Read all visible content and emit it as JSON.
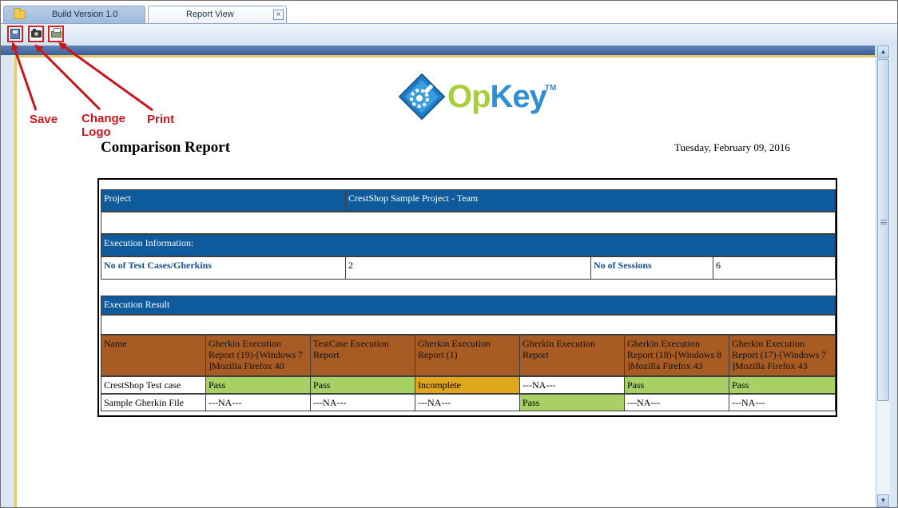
{
  "tabs": [
    {
      "label": "Build Version 1.0"
    },
    {
      "label": "Report View"
    }
  ],
  "annotations": {
    "save": "Save",
    "change_logo_line1": "Change",
    "change_logo_line2": "Logo",
    "print": "Print"
  },
  "logo": {
    "op": "Op",
    "key": "Key",
    "tm": "TM"
  },
  "report": {
    "title": "Comparison Report",
    "date": "Tuesday, February 09, 2016",
    "project_label": "Project",
    "project_value": "CrestShop Sample Project - Team",
    "execution_info_label": "Execution Information:",
    "test_cases_label": "No of Test Cases/Gherkins",
    "test_cases_value": "2",
    "sessions_label": "No of Sessions",
    "sessions_value": "6",
    "execution_result_label": "Execution Result",
    "columns": [
      "Name",
      "Gherkin Execution Report (19)-[Windows 7 ]Mozilla Firefox 40",
      "TestCase Execution Report",
      "Gherkin Execution Report (1)",
      "Gherkin Execution Report",
      "Gherkin Execution Report (18)-[Windows 8 ]Mozilla Firefox 43",
      "Gherkin Execution Report (17)-[Windows 7 ]Mozilla Firefox 43"
    ],
    "rows": [
      {
        "cells": [
          "CrestShop Test case",
          "Pass",
          "Pass",
          "Incomplete",
          "---NA---",
          "Pass",
          "Pass"
        ]
      },
      {
        "cells": [
          "Sample Gherkin File",
          "---NA---",
          "---NA---",
          "---NA---",
          "Pass",
          "---NA---",
          "---NA---"
        ]
      }
    ]
  },
  "colors": {
    "header_blue": "#0d5a9c",
    "column_brown": "#a85b22",
    "pass_green": "#a8d065",
    "incomplete_orange": "#e0a61d",
    "annotation_red": "#c8161d"
  },
  "icons": {
    "save": "floppy-disk-icon",
    "change_logo": "camera-icon",
    "print": "printer-icon",
    "tab": "folder-icon",
    "close": "close-icon"
  }
}
